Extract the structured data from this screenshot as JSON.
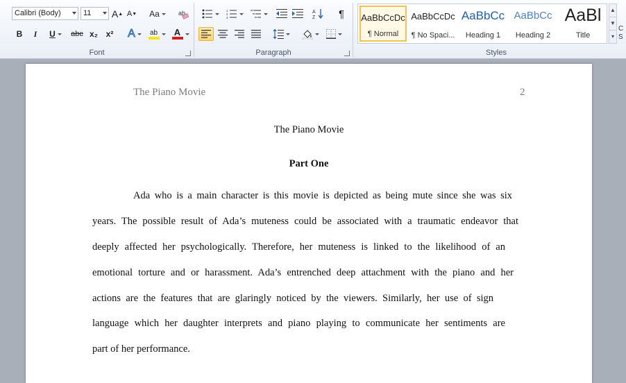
{
  "ribbon": {
    "font_group": {
      "label": "Font",
      "font_name": "Calibri (Body)",
      "font_size": "11",
      "grow_label": "A",
      "shrink_label": "A",
      "change_case_label": "Aa",
      "bold_label": "B",
      "italic_label": "I",
      "underline_label": "U",
      "strike_label": "abc",
      "subscript_label": "x₂",
      "superscript_label": "x²",
      "text_effects_label": "A",
      "highlight_label": "ab",
      "font_color_label": "A"
    },
    "paragraph_group": {
      "label": "Paragraph",
      "sort_label": "A↓Z",
      "pilcrow_label": "¶"
    },
    "styles_group": {
      "label": "Styles",
      "items": [
        {
          "sample": "AaBbCcDc",
          "name": "¶ Normal"
        },
        {
          "sample": "AaBbCcDc",
          "name": "¶ No Spaci..."
        },
        {
          "sample": "AaBbCc",
          "name": "Heading 1"
        },
        {
          "sample": "AaBbCc",
          "name": "Heading 2"
        },
        {
          "sample": "AaBl",
          "name": "Title"
        }
      ],
      "change_styles_label": "C\nS"
    },
    "colors": {
      "heading_blue": "#1f5fa8",
      "heading2_blue": "#4f81bd",
      "highlight_yellow": "#f7e41a",
      "font_color_red": "#d0201c",
      "active_border": "#e3b343"
    }
  },
  "document": {
    "header_left": "The Piano Movie",
    "page_number": "2",
    "title": "The Piano Movie",
    "subtitle": "Part One",
    "lines": [
      "Ada who is a main character is this movie is depicted as being mute since she was six",
      "years. The possible result of Ada’s muteness could be associated with a traumatic endeavor that",
      "deeply affected her psychologically.  Therefore, her muteness is linked to the likelihood of an",
      "emotional torture and or harassment.  Ada’s entrenched deep attachment with the piano and her",
      "actions are the features that are glaringly noticed by the viewers.  Similarly,  her use of sign",
      "language which her daughter interprets and piano playing  to communicate her sentiments are",
      "part of her performance."
    ]
  }
}
